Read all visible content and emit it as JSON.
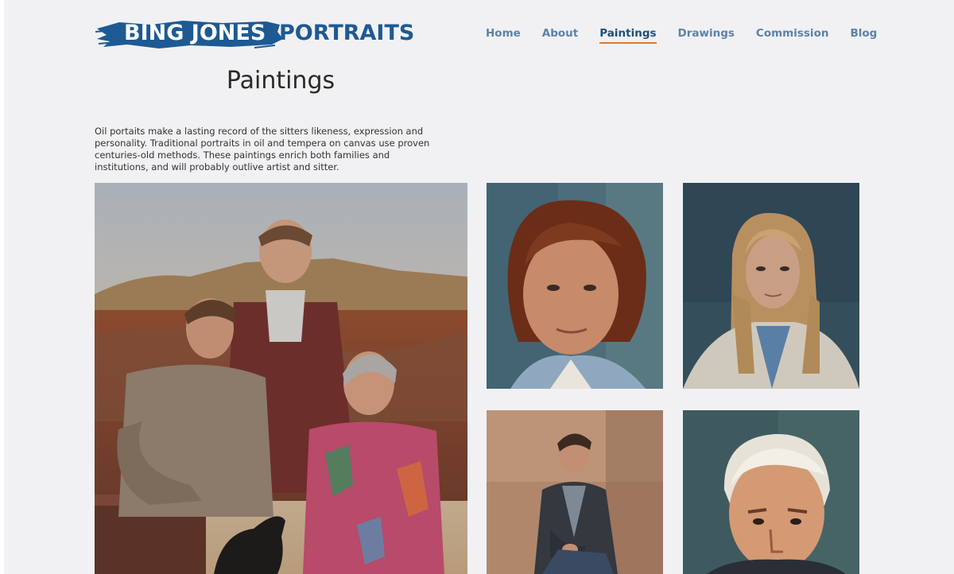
{
  "brand": {
    "name_part1": "BING JONES",
    "name_part2": "PORTRAITS"
  },
  "nav": {
    "items": [
      {
        "label": "Home"
      },
      {
        "label": "About"
      },
      {
        "label": "Paintings",
        "active": true
      },
      {
        "label": "Drawings"
      },
      {
        "label": "Commission"
      },
      {
        "label": "Blog"
      }
    ]
  },
  "page": {
    "title": "Paintings",
    "intro": "Oil portaits make a lasting record of the sitters likeness, expression and personality. Traditional portraits in oil and tempera on canvas use proven centuries-old methods. These paintings enrich both families and institutions, and will probably outlive artist and sitter."
  },
  "gallery": {
    "paintings": [
      {
        "id": "family",
        "subject": "family portrait with three sitters and dog"
      },
      {
        "id": "woman1",
        "subject": "woman with short auburn hair"
      },
      {
        "id": "woman2",
        "subject": "young woman with long blonde hair"
      },
      {
        "id": "man1",
        "subject": "young man in leather jacket"
      },
      {
        "id": "man2",
        "subject": "older man with white hair"
      }
    ]
  },
  "colors": {
    "brand_blue": "#1d5a93",
    "nav_text": "#5a83ab",
    "active_underline": "#e07a2c",
    "background": "#f1f1f3"
  }
}
